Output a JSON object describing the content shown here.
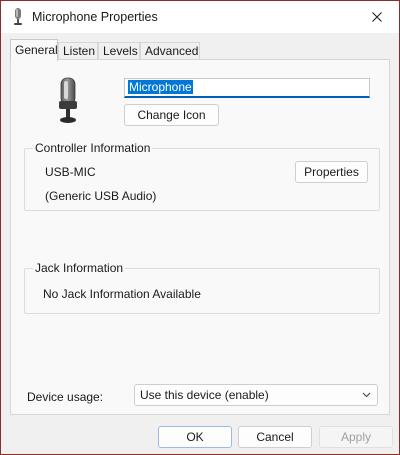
{
  "window": {
    "title": "Microphone Properties"
  },
  "tabs": [
    {
      "label": "General",
      "active": true
    },
    {
      "label": "Listen",
      "active": false
    },
    {
      "label": "Levels",
      "active": false
    },
    {
      "label": "Advanced",
      "active": false
    }
  ],
  "general": {
    "device_name": "Microphone",
    "change_icon_label": "Change Icon",
    "device_icon": "microphone-icon",
    "controller": {
      "title": "Controller Information",
      "name": "USB-MIC",
      "driver": "(Generic USB Audio)",
      "properties_label": "Properties"
    },
    "jack": {
      "title": "Jack Information",
      "text": "No Jack Information Available"
    },
    "device_usage": {
      "label": "Device usage:",
      "selected": "Use this device (enable)"
    }
  },
  "footer": {
    "ok_label": "OK",
    "cancel_label": "Cancel",
    "apply_label": "Apply"
  },
  "colors": {
    "accent": "#005fb8",
    "selection": "#0078d7",
    "window_border": "#8e2b2b"
  }
}
